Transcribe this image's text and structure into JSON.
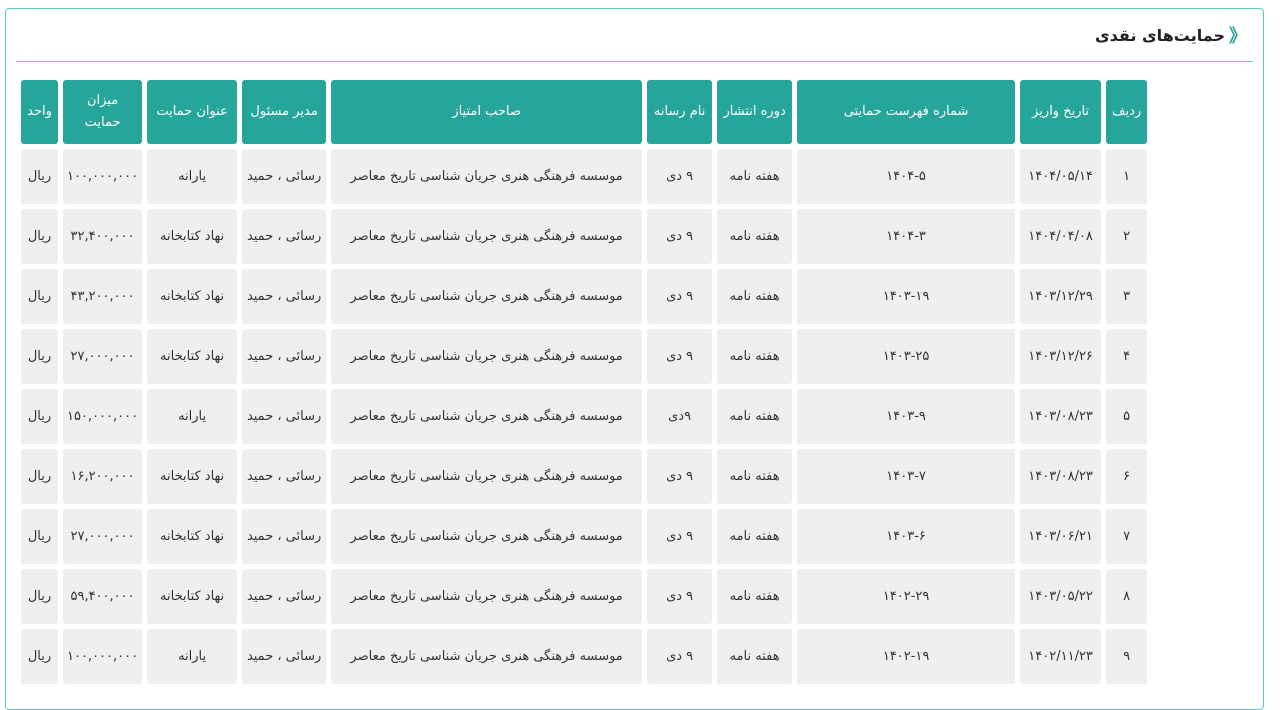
{
  "panel": {
    "title": "حمایت‌های نقدی",
    "chevron": "《"
  },
  "columns": [
    "ردیف",
    "تاریخ واریز",
    "شماره فهرست حمایتی",
    "دوره انتشار",
    "نام رسانه",
    "صاحب امتیاز",
    "مدیر مسئول",
    "عنوان حمایت",
    "میزان حمایت",
    "واحد"
  ],
  "rows": [
    [
      "۱",
      "۱۴۰۴/۰۵/۱۴",
      "۱۴۰۴-۵",
      "هفته نامه",
      "۹ دی",
      "موسسه فرهنگی هنری جریان شناسی تاریخ معاصر",
      "رسائی ، حمید",
      "یارانه",
      "۱۰۰,۰۰۰,۰۰۰",
      "ریال"
    ],
    [
      "۲",
      "۱۴۰۴/۰۴/۰۸",
      "۱۴۰۴-۳",
      "هفته نامه",
      "۹ دی",
      "موسسه فرهنگی هنری جریان شناسی تاریخ معاصر",
      "رسائی ، حمید",
      "نهاد کتابخانه",
      "۳۲,۴۰۰,۰۰۰",
      "ریال"
    ],
    [
      "۳",
      "۱۴۰۳/۱۲/۲۹",
      "۱۴۰۳-۱۹",
      "هفته نامه",
      "۹ دی",
      "موسسه فرهنگی هنری جریان شناسی تاریخ معاصر",
      "رسائی ، حمید",
      "نهاد کتابخانه",
      "۴۳,۲۰۰,۰۰۰",
      "ریال"
    ],
    [
      "۴",
      "۱۴۰۳/۱۲/۲۶",
      "۱۴۰۳-۲۵",
      "هفته نامه",
      "۹ دی",
      "موسسه فرهنگی هنری جریان شناسی تاریخ معاصر",
      "رسائی ، حمید",
      "نهاد کتابخانه",
      "۲۷,۰۰۰,۰۰۰",
      "ریال"
    ],
    [
      "۵",
      "۱۴۰۳/۰۸/۲۳",
      "۱۴۰۳-۹",
      "هفته نامه",
      "۹دی",
      "موسسه فرهنگی هنری جریان شناسی تاریخ معاصر",
      "رسائی ، حمید",
      "یارانه",
      "۱۵۰,۰۰۰,۰۰۰",
      "ریال"
    ],
    [
      "۶",
      "۱۴۰۳/۰۸/۲۳",
      "۱۴۰۳-۷",
      "هفته نامه",
      "۹ دی",
      "موسسه فرهنگی هنری جریان شناسی تاریخ معاصر",
      "رسائی ، حمید",
      "نهاد کتابخانه",
      "۱۶,۲۰۰,۰۰۰",
      "ریال"
    ],
    [
      "۷",
      "۱۴۰۳/۰۶/۲۱",
      "۱۴۰۳-۶",
      "هفته نامه",
      "۹ دی",
      "موسسه فرهنگی هنری جریان شناسی تاریخ معاصر",
      "رسائی ، حمید",
      "نهاد کتابخانه",
      "۲۷,۰۰۰,۰۰۰",
      "ریال"
    ],
    [
      "۸",
      "۱۴۰۳/۰۵/۲۲",
      "۱۴۰۲-۲۹",
      "هفته نامه",
      "۹ دی",
      "موسسه فرهنگی هنری جریان شناسی تاریخ معاصر",
      "رسائی ، حمید",
      "نهاد کتابخانه",
      "۵۹,۴۰۰,۰۰۰",
      "ریال"
    ],
    [
      "۹",
      "۱۴۰۲/۱۱/۲۳",
      "۱۴۰۲-۱۹",
      "هفته نامه",
      "۹ دی",
      "موسسه فرهنگی هنری جریان شناسی تاریخ معاصر",
      "رسائی ، حمید",
      "یارانه",
      "۱۰۰,۰۰۰,۰۰۰",
      "ریال"
    ]
  ],
  "colors": {
    "accent": "#26a69a",
    "border": "#5fc9c0",
    "cell": "#efefef"
  }
}
